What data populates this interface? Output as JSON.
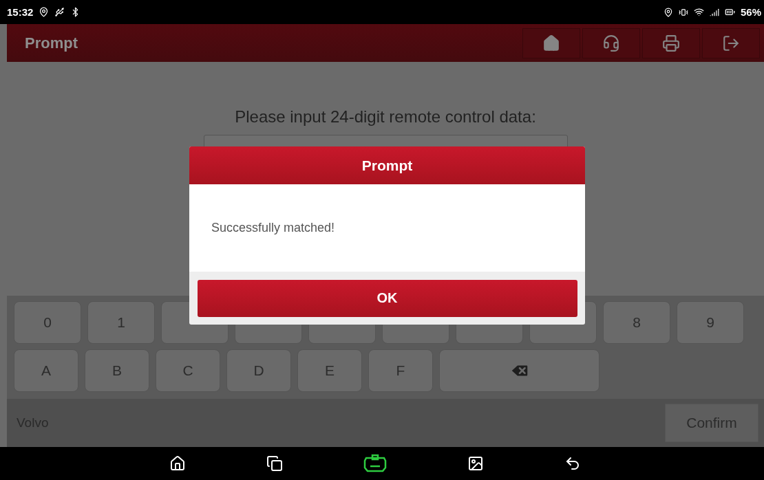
{
  "status_bar": {
    "time": "15:32",
    "battery": "56%"
  },
  "header": {
    "title": "Prompt",
    "tools": [
      {
        "kind": "home"
      },
      {
        "kind": "support"
      },
      {
        "kind": "print"
      },
      {
        "kind": "exit"
      }
    ]
  },
  "prompt": {
    "label": "Please input 24-digit remote control data:"
  },
  "keyboard": {
    "rows": [
      [
        {
          "kind": "char",
          "label": "0"
        },
        {
          "kind": "char",
          "label": "1"
        },
        {
          "kind": "covered"
        },
        {
          "kind": "covered"
        },
        {
          "kind": "covered"
        },
        {
          "kind": "covered"
        },
        {
          "kind": "covered"
        },
        {
          "kind": "covered"
        },
        {
          "kind": "char",
          "label": "8"
        },
        {
          "kind": "char",
          "label": "9"
        }
      ],
      [
        {
          "kind": "char",
          "label": "A"
        },
        {
          "kind": "char",
          "label": "B"
        },
        {
          "kind": "char",
          "label": "C"
        },
        {
          "kind": "char",
          "label": "D"
        },
        {
          "kind": "char",
          "label": "E"
        },
        {
          "kind": "char",
          "label": "F"
        },
        {
          "kind": "backspace"
        }
      ]
    ]
  },
  "footer": {
    "vehicle": "Volvo",
    "confirm": "Confirm"
  },
  "dialog": {
    "title": "Prompt",
    "message": "Successfully matched!",
    "ok": "OK"
  },
  "nav_bar": {
    "buttons": [
      {
        "kind": "home"
      },
      {
        "kind": "recents"
      },
      {
        "kind": "vci"
      },
      {
        "kind": "gallery"
      },
      {
        "kind": "back"
      }
    ]
  }
}
